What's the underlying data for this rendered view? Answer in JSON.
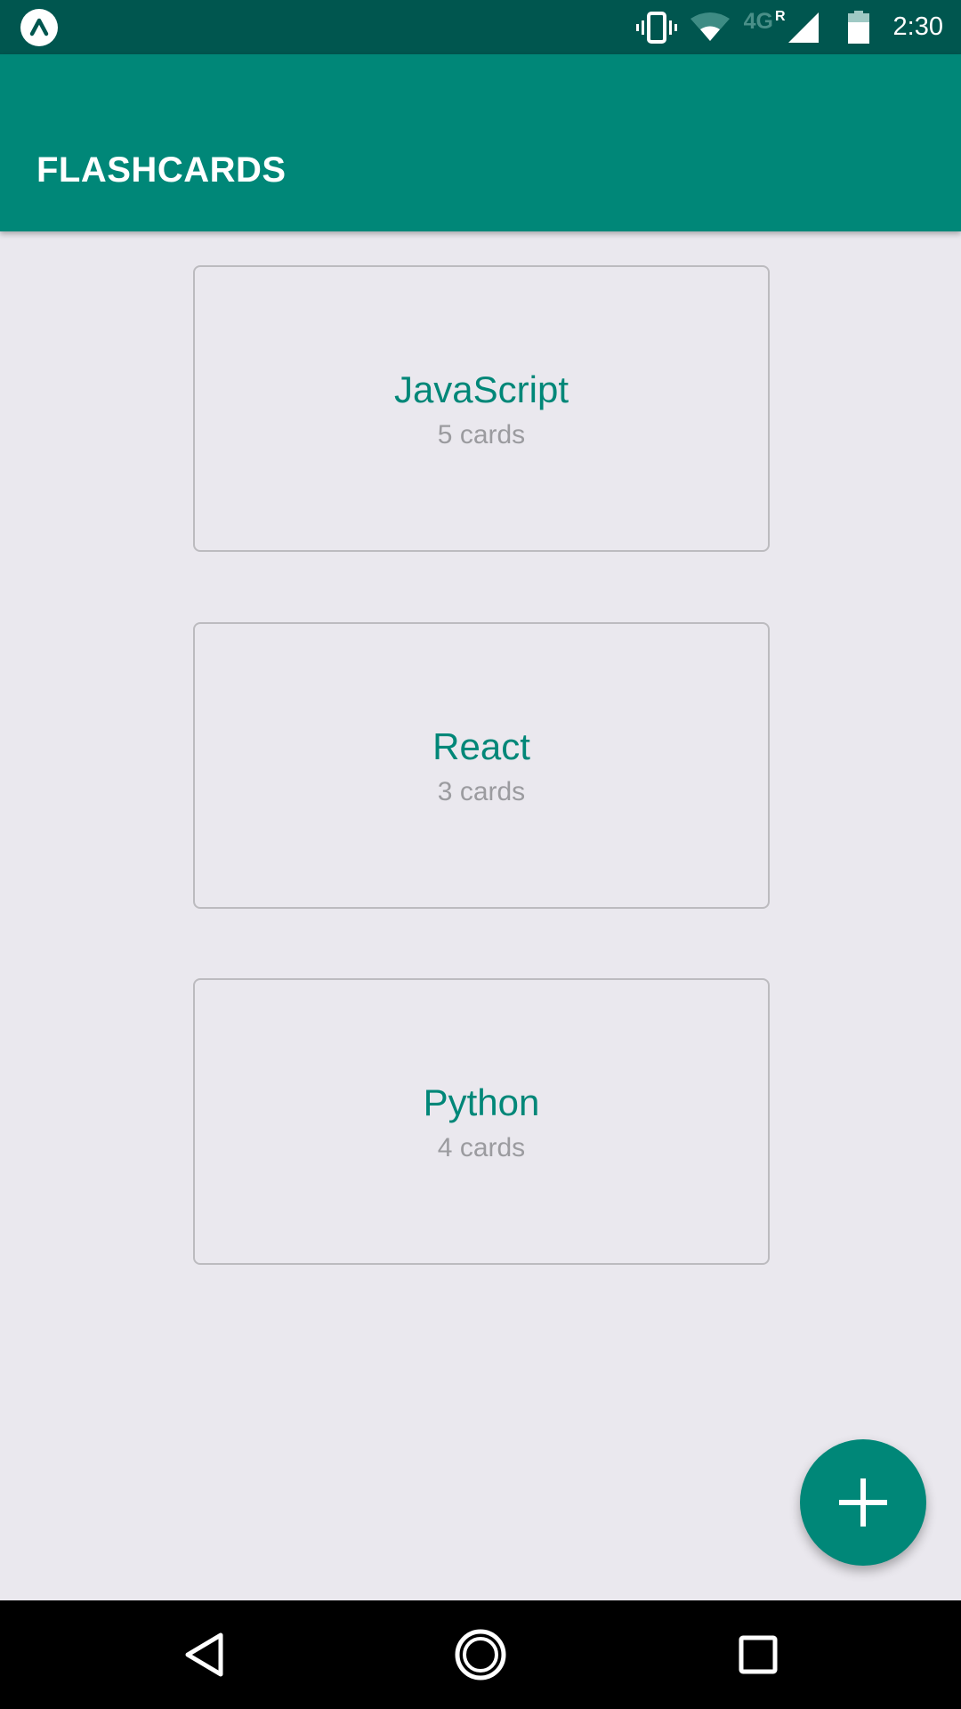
{
  "status_bar": {
    "network": "4G",
    "roaming": "R",
    "time": "2:30",
    "icons": [
      "expo-app-icon",
      "vibrate-icon",
      "wifi-icon",
      "cell-signal-icon",
      "battery-icon"
    ]
  },
  "app_bar": {
    "title": "FLASHCARDS"
  },
  "decks": [
    {
      "title": "JavaScript",
      "count": "5 cards"
    },
    {
      "title": "React",
      "count": "3 cards"
    },
    {
      "title": "Python",
      "count": "4 cards"
    }
  ],
  "fab": {
    "icon": "plus-icon"
  },
  "nav_bar": {
    "icons": [
      "back-icon",
      "home-icon",
      "recents-icon"
    ]
  },
  "colors": {
    "primary": "#008778",
    "primary_dark": "#00564f",
    "background": "#eae8ee",
    "card_border": "#bcbbbf",
    "secondary_text": "#9b9b9f"
  }
}
